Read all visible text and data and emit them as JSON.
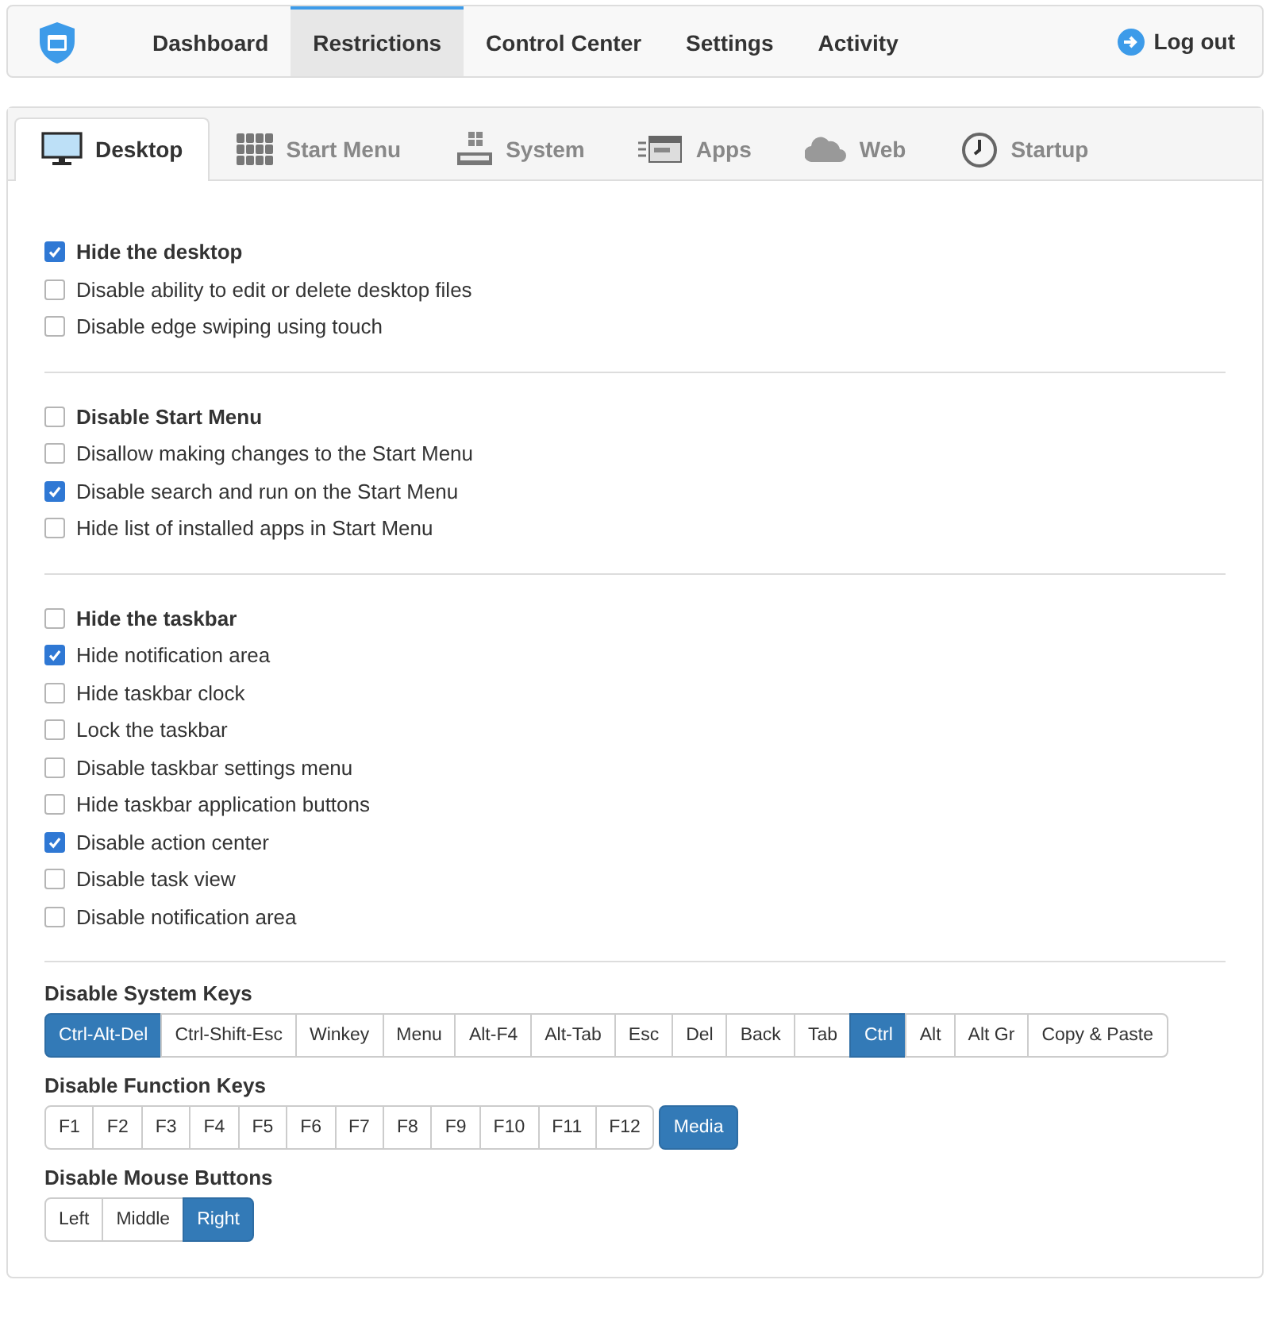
{
  "nav": {
    "items": [
      {
        "label": "Dashboard",
        "selected": false
      },
      {
        "label": "Restrictions",
        "selected": true
      },
      {
        "label": "Control Center",
        "selected": false
      },
      {
        "label": "Settings",
        "selected": false
      },
      {
        "label": "Activity",
        "selected": false
      }
    ],
    "logout": "Log out"
  },
  "tabs": [
    {
      "label": "Desktop",
      "selected": true
    },
    {
      "label": "Start Menu",
      "selected": false
    },
    {
      "label": "System",
      "selected": false
    },
    {
      "label": "Apps",
      "selected": false
    },
    {
      "label": "Web",
      "selected": false
    },
    {
      "label": "Startup",
      "selected": false
    }
  ],
  "sections": [
    {
      "options": [
        {
          "label": "Hide the desktop",
          "kind": "main",
          "checked": true
        },
        {
          "label": "Disable ability to edit or delete desktop files",
          "kind": "option",
          "checked": false
        },
        {
          "label": "Disable edge swiping using touch",
          "kind": "option",
          "checked": false
        }
      ]
    },
    {
      "options": [
        {
          "label": "Disable Start Menu",
          "kind": "main",
          "checked": false
        },
        {
          "label": "Disallow making changes to the Start Menu",
          "kind": "option",
          "checked": false
        },
        {
          "label": "Disable search and run on the Start Menu",
          "kind": "option",
          "checked": true
        },
        {
          "label": "Hide list of installed apps in Start Menu",
          "kind": "option",
          "checked": false
        }
      ]
    },
    {
      "options": [
        {
          "label": "Hide the taskbar",
          "kind": "main",
          "checked": false
        },
        {
          "label": "Hide notification area",
          "kind": "option",
          "checked": true
        },
        {
          "label": "Hide taskbar clock",
          "kind": "option",
          "checked": false
        },
        {
          "label": "Lock the taskbar",
          "kind": "option",
          "checked": false
        },
        {
          "label": "Disable taskbar settings menu",
          "kind": "option",
          "checked": false
        },
        {
          "label": "Hide taskbar application buttons",
          "kind": "option",
          "checked": false
        },
        {
          "label": "Disable action center",
          "kind": "option",
          "checked": true
        },
        {
          "label": "Disable task view",
          "kind": "option",
          "checked": false
        },
        {
          "label": "Disable notification area",
          "kind": "option",
          "checked": false
        }
      ]
    }
  ],
  "key_groups": [
    {
      "title": "Disable System Keys",
      "groups": [
        [
          {
            "label": "Ctrl-Alt-Del",
            "selected": true
          },
          {
            "label": "Ctrl-Shift-Esc",
            "selected": false
          },
          {
            "label": "Winkey",
            "selected": false
          },
          {
            "label": "Menu",
            "selected": false
          },
          {
            "label": "Alt-F4",
            "selected": false
          },
          {
            "label": "Alt-Tab",
            "selected": false
          },
          {
            "label": "Esc",
            "selected": false
          },
          {
            "label": "Del",
            "selected": false
          },
          {
            "label": "Back",
            "selected": false
          },
          {
            "label": "Tab",
            "selected": false
          },
          {
            "label": "Ctrl",
            "selected": true
          },
          {
            "label": "Alt",
            "selected": false
          },
          {
            "label": "Alt Gr",
            "selected": false
          },
          {
            "label": "Copy & Paste",
            "selected": false
          }
        ]
      ]
    },
    {
      "title": "Disable Function Keys",
      "groups": [
        [
          {
            "label": "F1",
            "selected": false
          },
          {
            "label": "F2",
            "selected": false
          },
          {
            "label": "F3",
            "selected": false
          },
          {
            "label": "F4",
            "selected": false
          },
          {
            "label": "F5",
            "selected": false
          },
          {
            "label": "F6",
            "selected": false
          },
          {
            "label": "F7",
            "selected": false
          },
          {
            "label": "F8",
            "selected": false
          },
          {
            "label": "F9",
            "selected": false
          },
          {
            "label": "F10",
            "selected": false
          },
          {
            "label": "F11",
            "selected": false
          },
          {
            "label": "F12",
            "selected": false
          }
        ],
        [
          {
            "label": "Media",
            "selected": true
          }
        ]
      ]
    },
    {
      "title": "Disable Mouse Buttons",
      "groups": [
        [
          {
            "label": "Left",
            "selected": false
          },
          {
            "label": "Middle",
            "selected": false
          },
          {
            "label": "Right",
            "selected": true
          }
        ]
      ]
    }
  ]
}
